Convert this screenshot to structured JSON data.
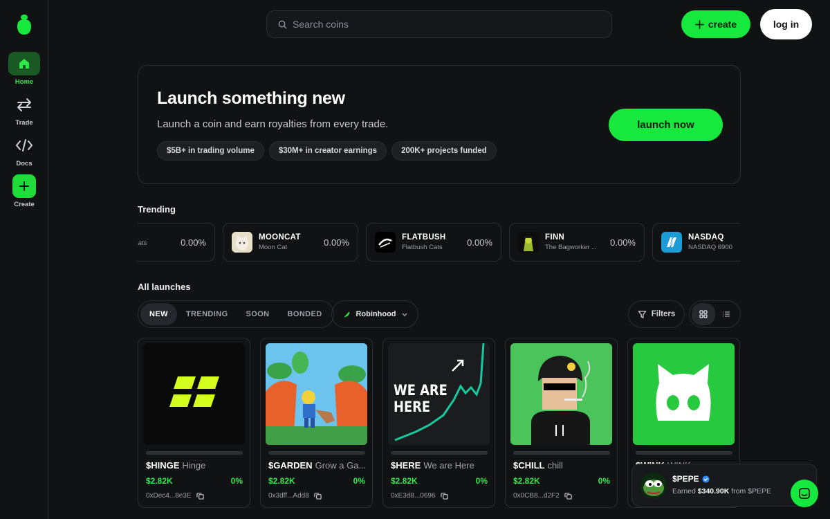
{
  "sidebar": {
    "items": [
      {
        "label": "Home"
      },
      {
        "label": "Trade"
      },
      {
        "label": "Docs"
      },
      {
        "label": "Create"
      }
    ]
  },
  "search": {
    "placeholder": "Search coins"
  },
  "header": {
    "create_label": "create",
    "login_label": "log in"
  },
  "hero": {
    "title": "Launch something new",
    "subtitle": "Launch a coin and earn royalties from every trade.",
    "stats": [
      "$5B+ in trading volume",
      "$30M+ in creator earnings",
      "200K+ projects funded"
    ],
    "cta_label": "launch now"
  },
  "trending": {
    "title": "Trending",
    "items": [
      {
        "ticker": "",
        "name": "Good Cats",
        "pct": "0.00%"
      },
      {
        "ticker": "MOONCAT",
        "name": "Moon Cat",
        "pct": "0.00%"
      },
      {
        "ticker": "FLATBUSH",
        "name": "Flatbush Cats",
        "pct": "0.00%"
      },
      {
        "ticker": "FINN",
        "name": "The Bagworker ...",
        "pct": "0.00%"
      },
      {
        "ticker": "NASDAQ",
        "name": "NASDAQ 6900",
        "pct": ""
      }
    ]
  },
  "launches": {
    "title": "All launches",
    "tabs": [
      "NEW",
      "TRENDING",
      "SOON",
      "BONDED"
    ],
    "chain": "Robinhood",
    "filters_label": "Filters",
    "coins": [
      {
        "ticker": "$HINGE",
        "name": "Hinge",
        "mcap": "$2.82K",
        "pct": "0%",
        "address": "0xDec4...8e3E"
      },
      {
        "ticker": "$GARDEN",
        "name": "Grow a Ga...",
        "mcap": "$2.82K",
        "pct": "0%",
        "address": "0x3dff...Add8"
      },
      {
        "ticker": "$HERE",
        "name": "We are Here",
        "mcap": "$2.82K",
        "pct": "0%",
        "address": "0xE3d8...0696"
      },
      {
        "ticker": "$CHILL",
        "name": "chill",
        "mcap": "$2.82K",
        "pct": "0%",
        "address": "0x0CB8...d2F2"
      },
      {
        "ticker": "$WINK",
        "name": "WINK",
        "mcap": "",
        "pct": "",
        "address": ""
      }
    ],
    "here_image_text": [
      "WE ARE",
      "HERE"
    ]
  },
  "toast": {
    "ticker": "$PEPE",
    "prefix": "Earned",
    "amount": "$340.90K",
    "from": "from $PEPE"
  },
  "colors": {
    "accent": "#16e83d",
    "bg": "#111214",
    "border": "#2a2d33"
  }
}
